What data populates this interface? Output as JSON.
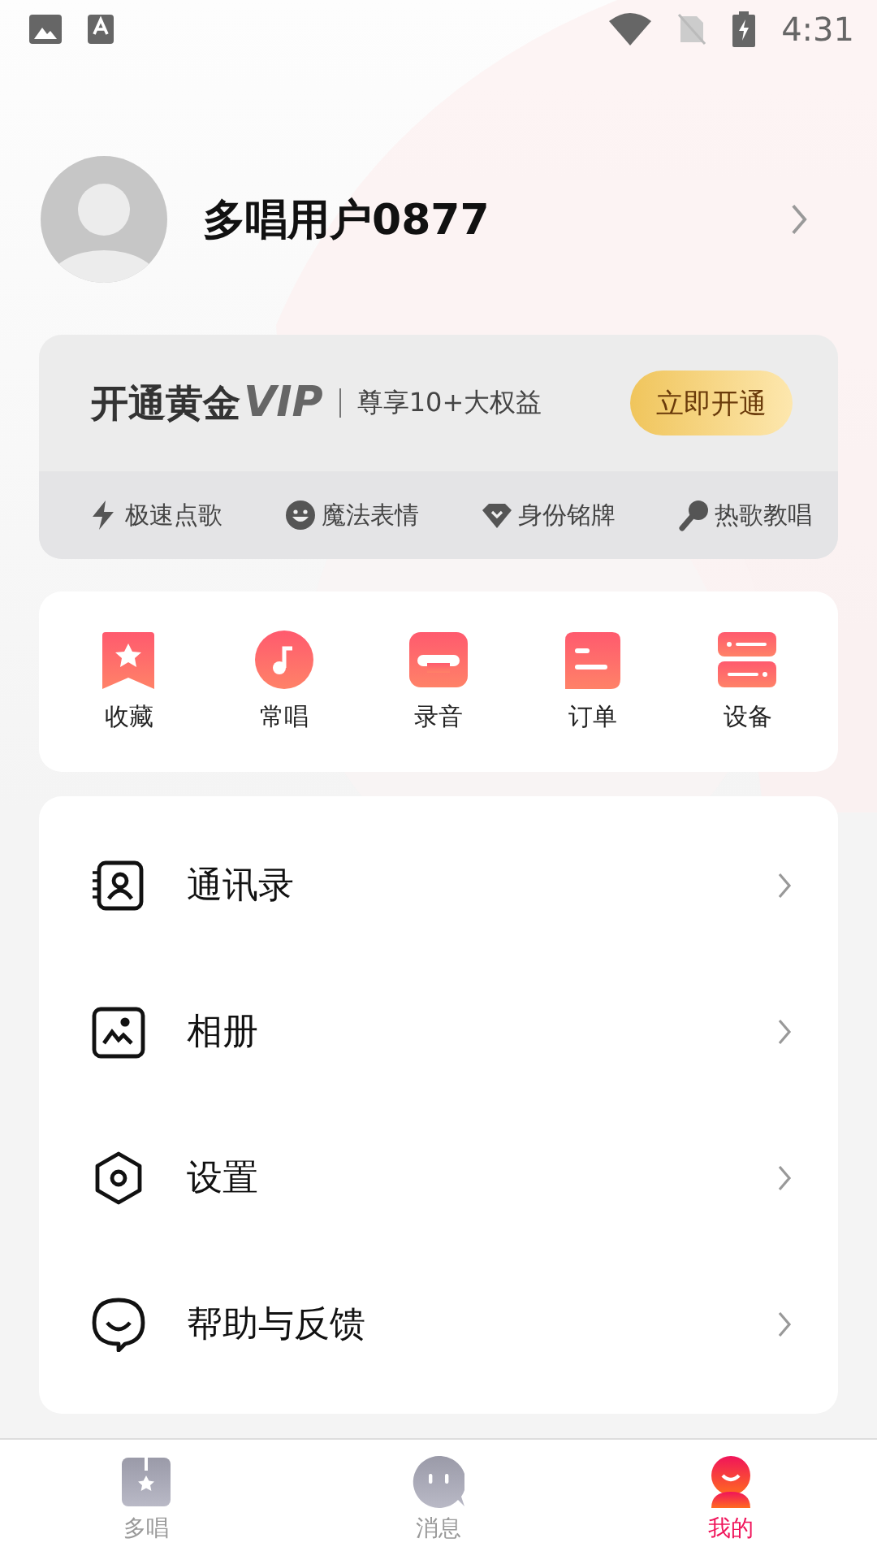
{
  "status_bar": {
    "time": "4:31"
  },
  "profile": {
    "name": "多唱用户0877"
  },
  "vip": {
    "title": "开通黄金",
    "badge": "VIP",
    "subtitle": "尊享10+大权益",
    "button": "立即开通",
    "perks": [
      {
        "kind": "bolt",
        "label": "极速点歌"
      },
      {
        "kind": "smile",
        "label": "魔法表情"
      },
      {
        "kind": "gem",
        "label": "身份铭牌"
      },
      {
        "kind": "mic",
        "label": "热歌教唱"
      }
    ]
  },
  "shortcuts": [
    {
      "kind": "bookmark",
      "label": "收藏"
    },
    {
      "kind": "note",
      "label": "常唱"
    },
    {
      "kind": "record",
      "label": "录音"
    },
    {
      "kind": "order",
      "label": "订单"
    },
    {
      "kind": "device",
      "label": "设备"
    }
  ],
  "menu": [
    {
      "kind": "contacts",
      "label": "通讯录"
    },
    {
      "kind": "album",
      "label": "相册"
    },
    {
      "kind": "settings",
      "label": "设置"
    },
    {
      "kind": "help",
      "label": "帮助与反馈"
    }
  ],
  "tabs": [
    {
      "kind": "home",
      "label": "多唱",
      "selected": false
    },
    {
      "kind": "message",
      "label": "消息",
      "selected": false
    },
    {
      "kind": "me",
      "label": "我的",
      "selected": true
    }
  ]
}
